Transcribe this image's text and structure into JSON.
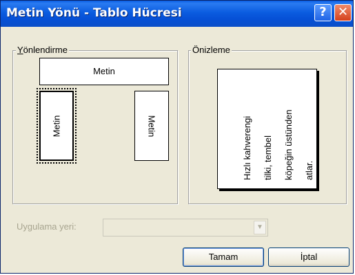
{
  "window": {
    "title": "Metin Yönü - Tablo Hücresi",
    "help_glyph": "?",
    "close_glyph": "✕"
  },
  "orientation_group": {
    "label": "Yönlendirme",
    "options": [
      {
        "label": "Metin",
        "direction": "horizontal",
        "selected": false
      },
      {
        "label": "Metin",
        "direction": "vertical-bottom-to-top",
        "selected": true
      },
      {
        "label": "Metin",
        "direction": "vertical-top-to-bottom",
        "selected": false
      }
    ]
  },
  "preview_group": {
    "label": "Önizleme",
    "sample_lines": [
      "Hızlı kahverengi",
      "tilki, tembel",
      "köpeğin üstünden",
      "atlar."
    ]
  },
  "apply_to": {
    "label": "Uygulama yeri:",
    "value": "",
    "enabled": false
  },
  "buttons": {
    "ok": "Tamam",
    "cancel": "İptal"
  },
  "colors": {
    "titlebar": "#0b5ce0",
    "dialog_bg": "#ece9d8",
    "disabled_text": "#a8a590",
    "close_button": "#d4401c"
  }
}
